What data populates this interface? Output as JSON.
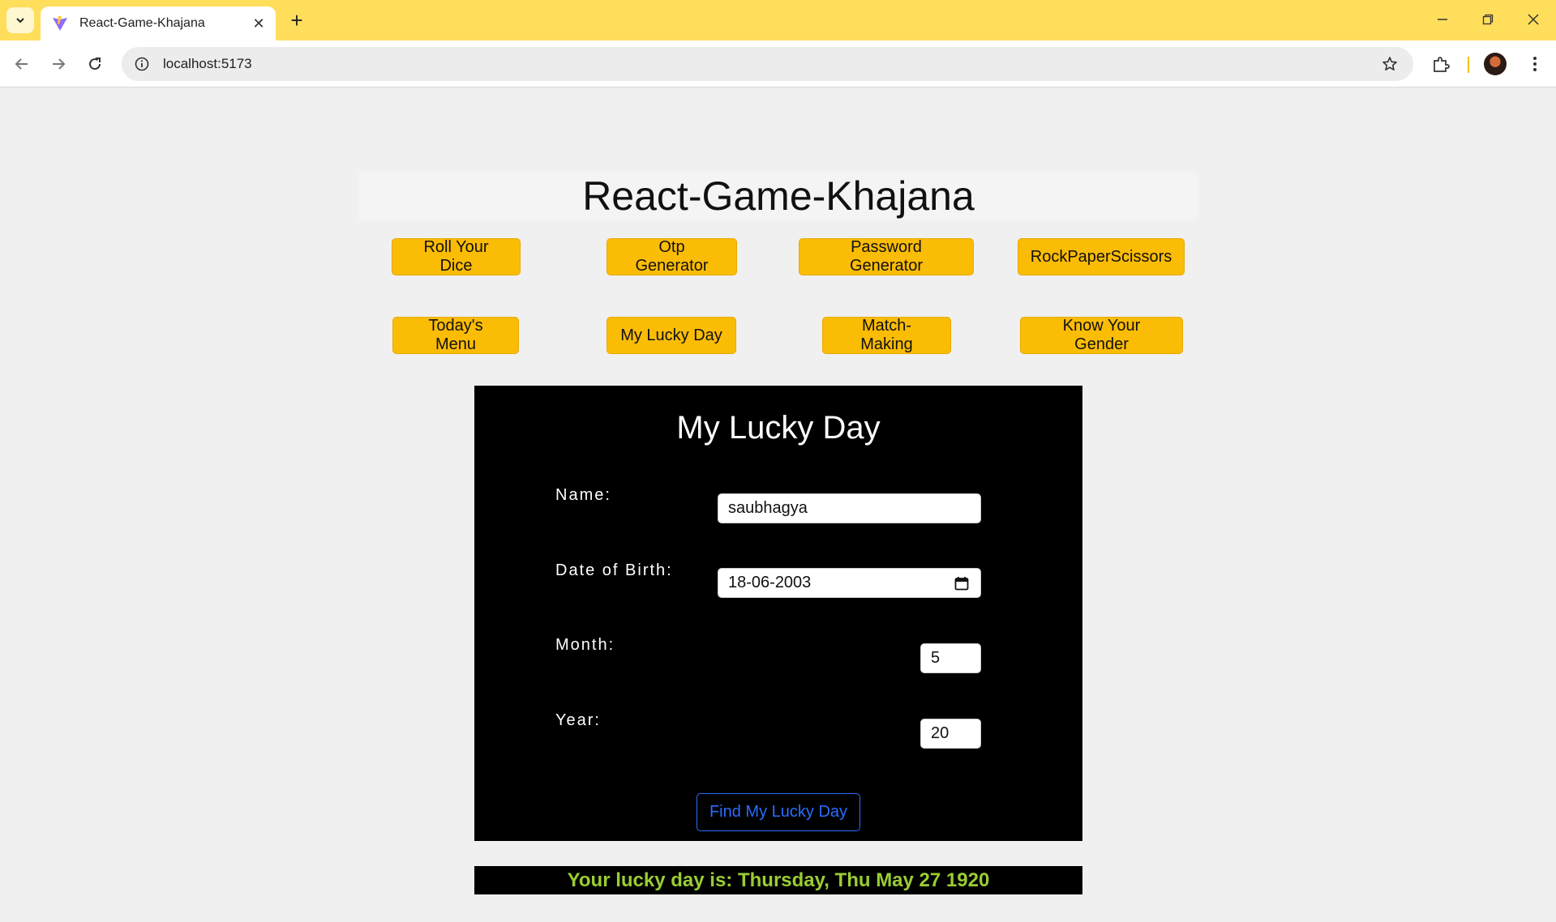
{
  "browser": {
    "tab_title": "React-Game-Khajana",
    "url": "localhost:5173",
    "accent_color": "#ffde5c"
  },
  "app": {
    "title": "React-Game-Khajana",
    "nav_buttons": [
      "Roll Your Dice",
      "Otp Generator",
      "Password Generator",
      "RockPaperScissors",
      "Today's Menu",
      "My Lucky Day",
      "Match-Making",
      "Know Your Gender"
    ],
    "button_color": "#fbbc05"
  },
  "lucky_day": {
    "heading": "My Lucky Day",
    "name_label": "Name:",
    "name_value": "saubhagya",
    "dob_label": "Date of Birth:",
    "dob_value": "18-06-2003",
    "month_label": "Month:",
    "month_value": "5",
    "year_label": "Year:",
    "year_value": "20",
    "submit_label": "Find My Lucky Day"
  },
  "result": {
    "text": "Your lucky day is: Thursday, Thu May 27 1920",
    "color": "#9acd32"
  }
}
